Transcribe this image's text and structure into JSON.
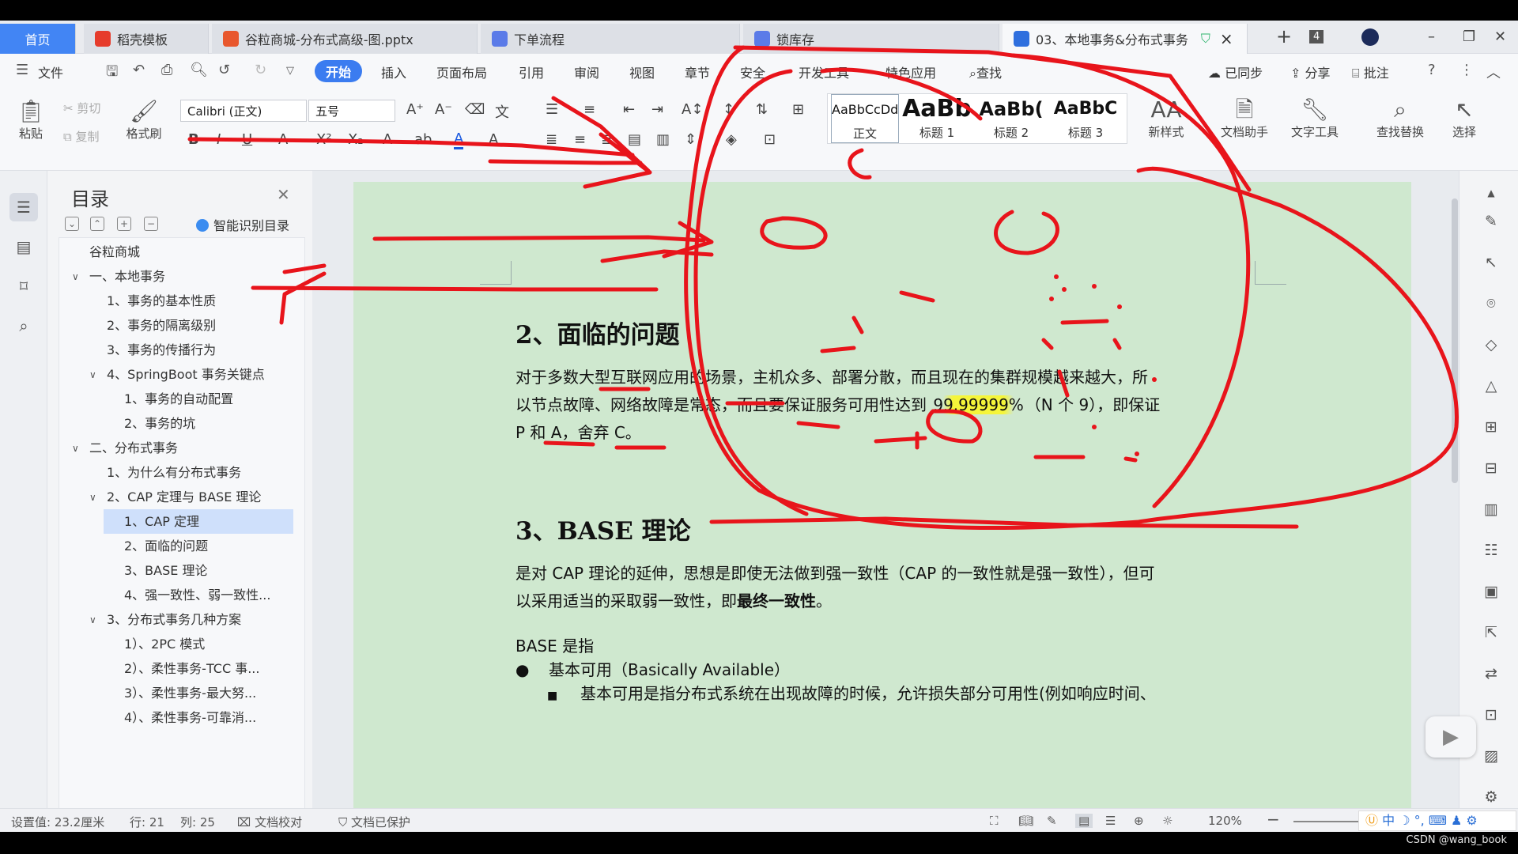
{
  "watermark": "CSDN @wang_book",
  "tabs": [
    {
      "label": "首页",
      "kind": "home"
    },
    {
      "label": "稻壳模板",
      "icon": "docer-icon",
      "color": "#e63c2c"
    },
    {
      "label": "谷粒商城-分布式高级-图.pptx",
      "icon": "ppt-icon",
      "color": "#e8572d"
    },
    {
      "label": "下单流程",
      "icon": "flow-icon",
      "color": "#5b7be8"
    },
    {
      "label": "锁库存",
      "icon": "flow-icon",
      "color": "#5b7be8"
    },
    {
      "label": "03、本地事务&分布式事务",
      "icon": "word-icon",
      "color": "#2f6fde"
    }
  ],
  "tab_badge": "4",
  "menu": {
    "file": "文件",
    "items": [
      "开始",
      "插入",
      "页面布局",
      "引用",
      "审阅",
      "视图",
      "章节",
      "安全",
      "开发工具",
      "特色应用"
    ],
    "search": "查找",
    "synced": "已同步",
    "share": "分享",
    "annotate": "批注"
  },
  "ribbon": {
    "paste": "粘贴",
    "cut": "剪切",
    "copy": "复制",
    "format_painter": "格式刷",
    "font_name": "Calibri (正文)",
    "font_size": "五号",
    "styles": [
      {
        "sample": "AaBbCcDd",
        "name": "正文"
      },
      {
        "sample": "AaBb",
        "name": "标题 1"
      },
      {
        "sample": "AaBb(",
        "name": "标题 2"
      },
      {
        "sample": "AaBbC",
        "name": "标题 3"
      }
    ],
    "new_style": "新样式",
    "doc_assistant": "文档助手",
    "text_tools": "文字工具",
    "find_replace": "查找替换",
    "select": "选择"
  },
  "toc": {
    "title": "目录",
    "smart": "智能识别目录",
    "items": [
      {
        "label": "谷粒商城",
        "level": 0
      },
      {
        "label": "一、本地事务",
        "level": 0,
        "expanded": true
      },
      {
        "label": "1、事务的基本性质",
        "level": 1
      },
      {
        "label": "2、事务的隔离级别",
        "level": 1
      },
      {
        "label": "3、事务的传播行为",
        "level": 1
      },
      {
        "label": "4、SpringBoot 事务关键点",
        "level": 1,
        "expanded": true
      },
      {
        "label": "1、事务的自动配置",
        "level": 2
      },
      {
        "label": "2、事务的坑",
        "level": 2
      },
      {
        "label": "二、分布式事务",
        "level": 0,
        "expanded": true
      },
      {
        "label": "1、为什么有分布式事务",
        "level": 1
      },
      {
        "label": "2、CAP 定理与 BASE 理论",
        "level": 1,
        "expanded": true
      },
      {
        "label": "1、CAP 定理",
        "level": 2,
        "selected": true
      },
      {
        "label": "2、面临的问题",
        "level": 2
      },
      {
        "label": "3、BASE 理论",
        "level": 2
      },
      {
        "label": "4、强一致性、弱一致性...",
        "level": 2
      },
      {
        "label": "3、分布式事务几种方案",
        "level": 1,
        "expanded": true
      },
      {
        "label": "1）、2PC 模式",
        "level": 2
      },
      {
        "label": "2）、柔性事务-TCC 事...",
        "level": 2
      },
      {
        "label": "3）、柔性事务-最大努...",
        "level": 2
      },
      {
        "label": "4）、柔性事务-可靠消..."
      }
    ]
  },
  "doc": {
    "h2": "2、面临的问题",
    "p1_line1": "对于多数大型互联网应用的场景，主机众多、部署分散，而且现在的集群规模越来越大，所",
    "p1_line2a": "以节点故障、网络故障是常态，而且要保证服务可用性达到 ",
    "p1_highlight": "99.99999%",
    "p1_line2b": "（N 个 9），即保证",
    "p1_line3": "P 和 A，舍弃 C。",
    "h3": "3、BASE 理论",
    "p2_line1": "是对 CAP 理论的延伸，思想是即使无法做到强一致性（CAP 的一致性就是强一致性），但可",
    "p2_line2a": "以采用适当的采取弱一致性，即",
    "p2_line2b": "最终一致性",
    "p2_line2c": "。",
    "p3": "BASE 是指",
    "bullet1": "基本可用（Basically Available）",
    "bullet2": "基本可用是指分布式系统在出现故障的时候，允许损失部分可用性(例如响应时间、"
  },
  "status": {
    "setting": "设置值: 23.2厘米",
    "row": "行: 21",
    "col": "列: 25",
    "proof": "文档校对",
    "protected": "文档已保护",
    "zoom": "120%"
  },
  "ime": "中"
}
